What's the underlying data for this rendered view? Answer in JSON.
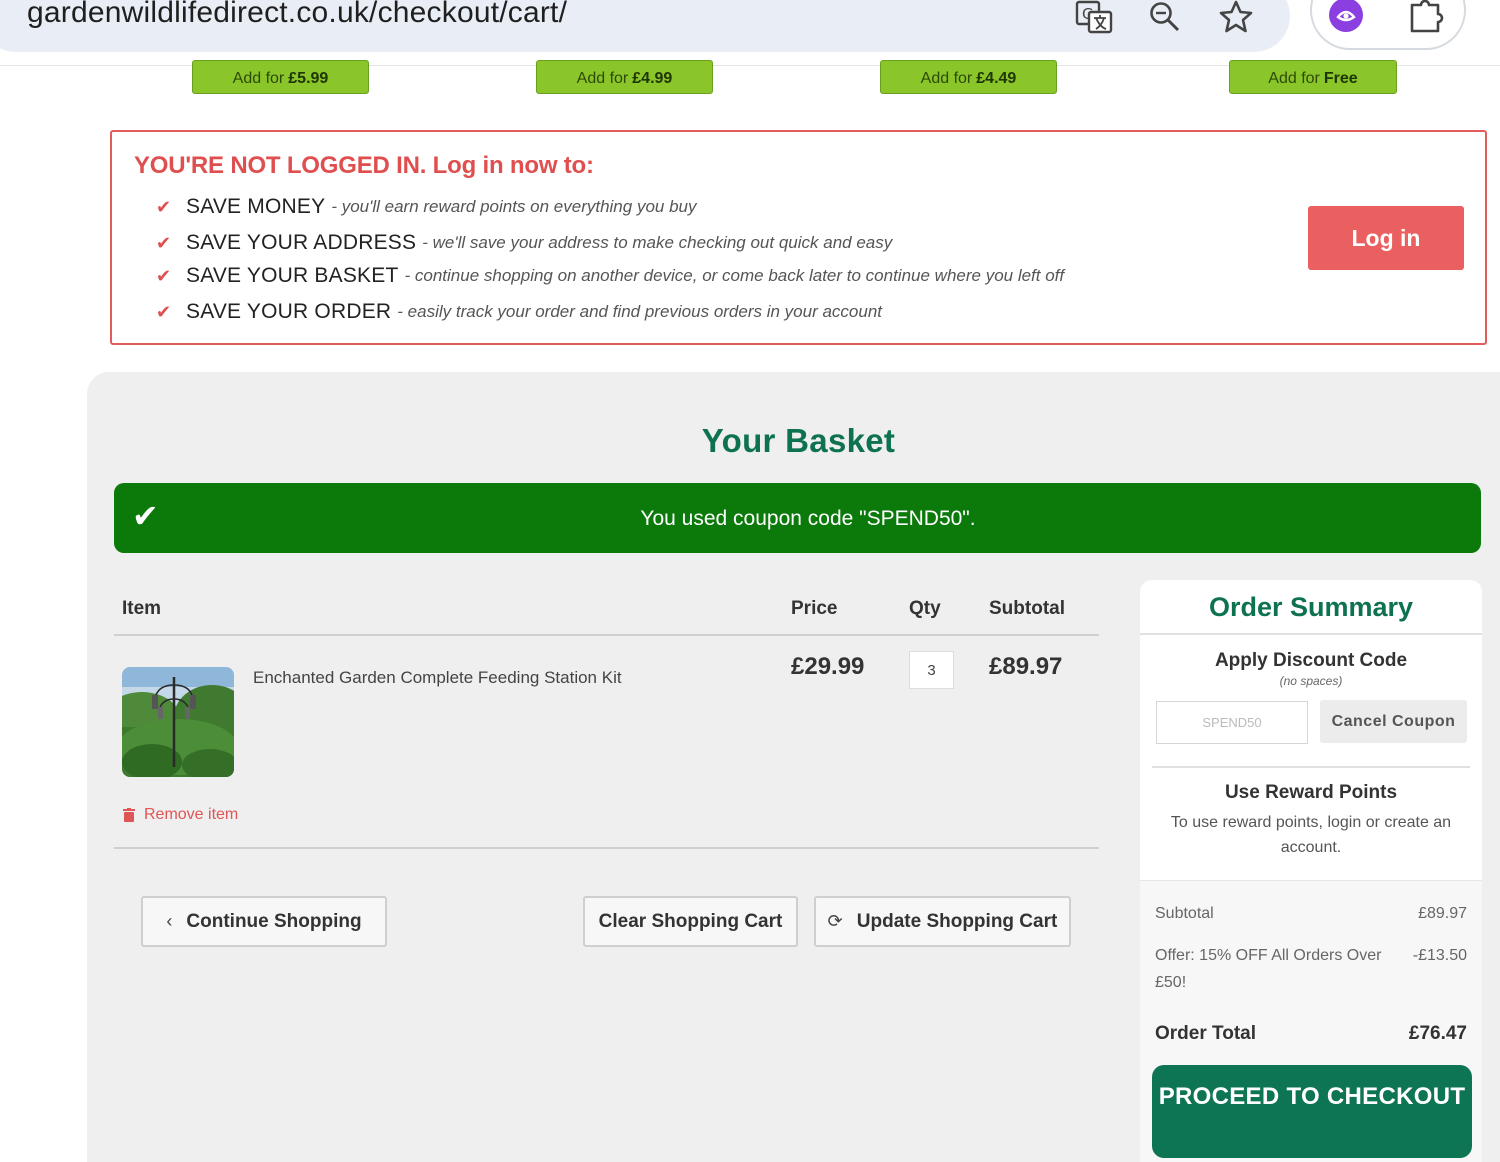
{
  "browser": {
    "url": "gardenwildlifedirect.co.uk/checkout/cart/",
    "icons": [
      "translate-icon",
      "zoom-icon",
      "star-icon",
      "extension-icon",
      "puzzle-icon"
    ]
  },
  "upsells": [
    {
      "prefix": "Add for",
      "price": "£5.99"
    },
    {
      "prefix": "Add for",
      "price": "£4.99"
    },
    {
      "prefix": "Add for",
      "price": "£4.49"
    },
    {
      "prefix": "Add for",
      "price": "Free"
    }
  ],
  "login_prompt": {
    "title": "YOU'RE NOT LOGGED IN. Log in now to:",
    "benefits": [
      {
        "label": "SAVE MONEY",
        "description": "- you'll earn reward points on everything you buy"
      },
      {
        "label": "SAVE YOUR ADDRESS",
        "description": "- we'll save your address to make checking out quick and easy"
      },
      {
        "label": "SAVE YOUR BASKET",
        "description": "- continue shopping on another device, or come back later to continue where you left off"
      },
      {
        "label": "SAVE YOUR ORDER",
        "description": "- easily track your order and find previous orders in your account"
      }
    ],
    "button": "Log in"
  },
  "basket": {
    "title": "Your Basket",
    "coupon_message": "You used coupon code \"SPEND50\".",
    "columns": {
      "item": "Item",
      "price": "Price",
      "qty": "Qty",
      "subtotal": "Subtotal"
    },
    "items": [
      {
        "name": "Enchanted Garden Complete Feeding Station Kit",
        "price": "£29.99",
        "qty": "3",
        "subtotal": "£89.97",
        "remove_label": "Remove item"
      }
    ],
    "buttons": {
      "continue": "Continue Shopping",
      "clear": "Clear Shopping Cart",
      "update": "Update Shopping Cart"
    }
  },
  "summary": {
    "title": "Order Summary",
    "discount_title": "Apply Discount Code",
    "discount_sub": "(no spaces)",
    "discount_value": "SPEND50",
    "cancel_coupon": "Cancel Coupon",
    "reward_title": "Use Reward Points",
    "reward_text": "To use reward points, login or create an account.",
    "subtotal_label": "Subtotal",
    "subtotal_value": "£89.97",
    "offer_label": "Offer: 15% OFF All Orders Over £50!",
    "offer_value": "-£13.50",
    "total_label": "Order Total",
    "total_value": "£76.47",
    "checkout": "PROCEED TO CHECKOUT"
  },
  "colors": {
    "brand_green": "#0e7250",
    "alert_red": "#e04f4f",
    "success_green": "#0b7a0b",
    "upsell_green": "#8ac52a"
  }
}
